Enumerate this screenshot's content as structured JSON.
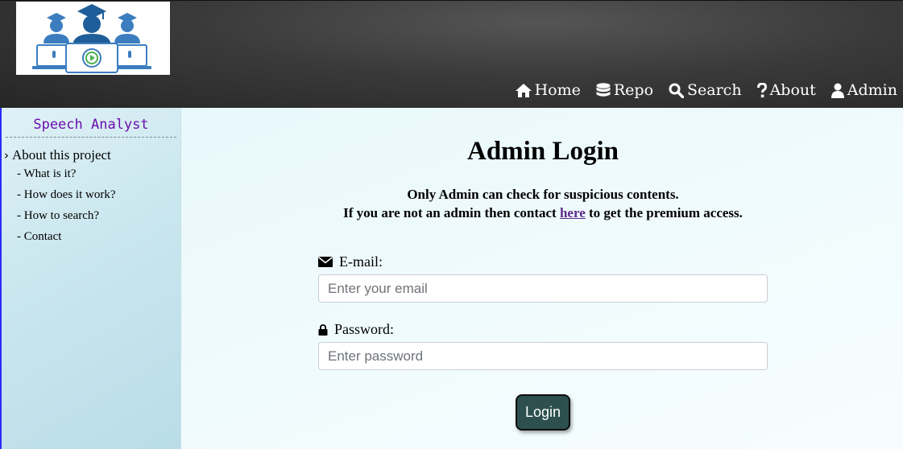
{
  "colors": {
    "header_bg": "#333333",
    "sidebar_title": "#6a0dad",
    "sidebar_border": "#2b2bff",
    "link": "#5b2a86",
    "button_bg": "#2d504f",
    "logo_blue": "#3b7dbf"
  },
  "nav": {
    "items": [
      {
        "label": "Home",
        "icon": "home-icon"
      },
      {
        "label": "Repo",
        "icon": "database-icon"
      },
      {
        "label": "Search",
        "icon": "search-icon"
      },
      {
        "label": "About",
        "icon": "question-icon"
      },
      {
        "label": "Admin",
        "icon": "user-icon"
      }
    ]
  },
  "sidebar": {
    "title": "Speech Analyst",
    "section": "About this project",
    "links": [
      "- What is it?",
      "- How does it work?",
      "- How to search?",
      "- Contact"
    ]
  },
  "main": {
    "title": "Admin Login",
    "intro_line1": "Only Admin can check for suspicious contents.",
    "intro_line2_before": "If you are not an admin then contact ",
    "intro_link": "here",
    "intro_line2_after": " to get the premium access.",
    "email_label": "E-mail:",
    "email_placeholder": "Enter your email",
    "password_label": "Password:",
    "password_placeholder": "Enter password",
    "login_button": "Login"
  }
}
